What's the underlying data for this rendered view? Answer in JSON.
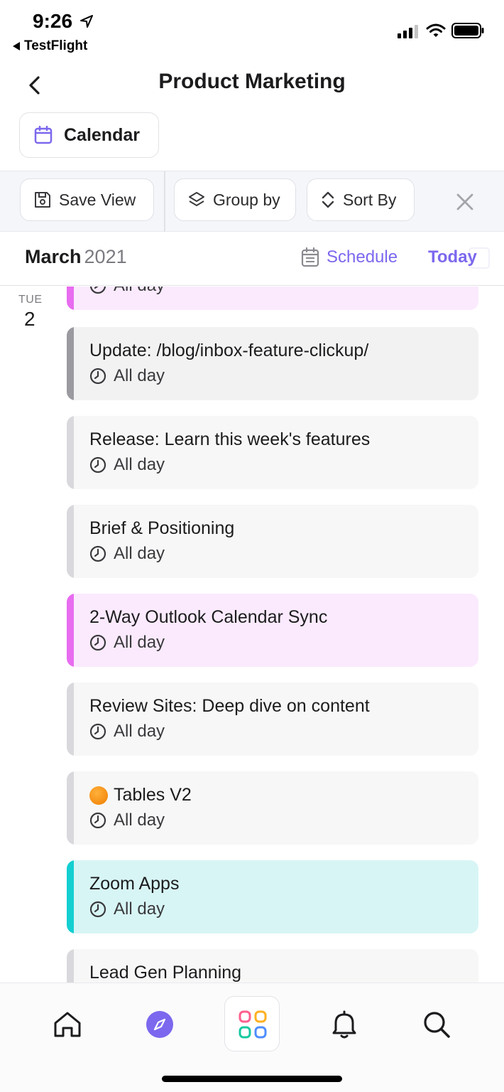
{
  "status_bar": {
    "time": "9:26",
    "back_app": "TestFlight"
  },
  "header": {
    "title": "Product Marketing",
    "view_label": "Calendar"
  },
  "toolbar": {
    "save_view": "Save View",
    "group_by": "Group by",
    "sort_by": "Sort By"
  },
  "calendar": {
    "month": "March",
    "year": "2021",
    "schedule_label": "Schedule",
    "today_label": "Today",
    "day": {
      "weekday": "TUE",
      "number": "2"
    }
  },
  "colors": {
    "accent": "#7b68ee",
    "pink_bar": "#e86cf0",
    "pink_bg": "#fbeafd",
    "gray_bar": "#9a9aa0",
    "gray_bg": "#f2f2f3",
    "light_bar": "#d9d9dd",
    "light_bg": "#f7f7f7",
    "teal_bar": "#14cfd1",
    "teal_bg": "#d8f5f5"
  },
  "tasks": [
    {
      "title": "",
      "time": "All day",
      "style": "pink"
    },
    {
      "title": "Update: /blog/inbox-feature-clickup/",
      "time": "All day",
      "style": "gray"
    },
    {
      "title": "Release: Learn this week's features",
      "time": "All day",
      "style": "light"
    },
    {
      "title": "Brief & Positioning",
      "time": "All day",
      "style": "light"
    },
    {
      "title": "2-Way Outlook Calendar Sync",
      "time": "All day",
      "style": "pink"
    },
    {
      "title": "Review Sites: Deep dive on content",
      "time": "All day",
      "style": "light"
    },
    {
      "title": "Tables V2",
      "time": "All day",
      "style": "light",
      "icon": "orange-circle-emoji"
    },
    {
      "title": "Zoom Apps",
      "time": "All day",
      "style": "teal"
    },
    {
      "title": "Lead Gen Planning",
      "time": "",
      "style": "light"
    }
  ],
  "tabbar": {
    "items": [
      "home-icon",
      "compass-icon",
      "apps-grid-icon",
      "bell-icon",
      "search-icon"
    ]
  }
}
